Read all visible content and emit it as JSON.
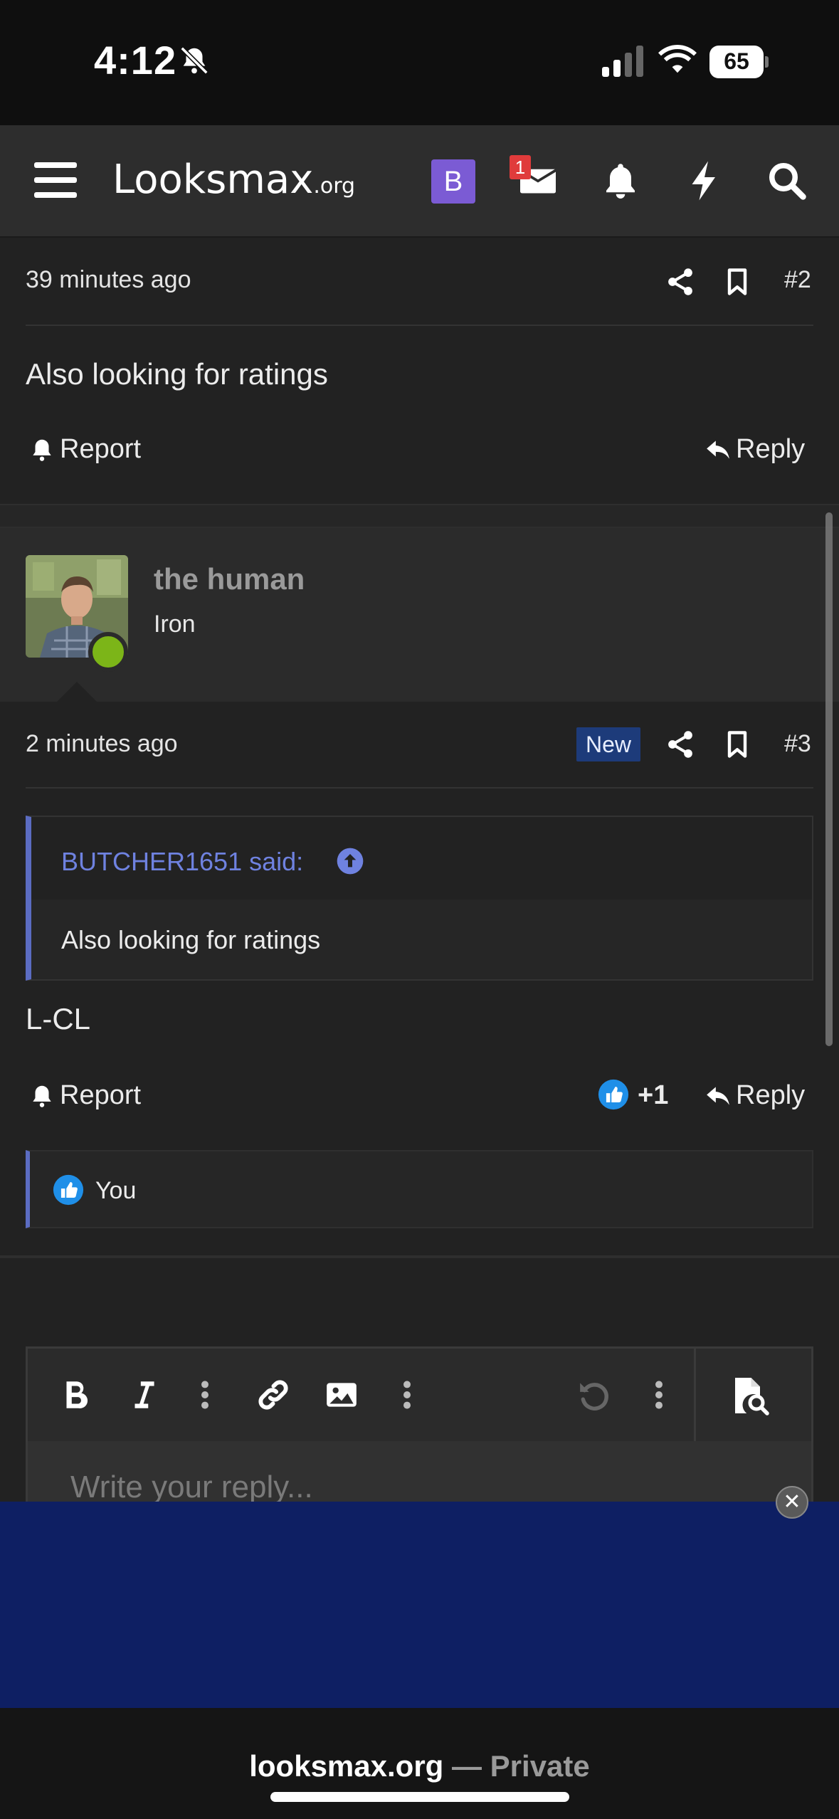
{
  "status_bar": {
    "time": "4:12",
    "battery": "65",
    "battery_level": 0.65
  },
  "nav": {
    "logo": "Looksmax",
    "logo_tld": ".org",
    "avatar_letter": "B",
    "inbox_badge": "1",
    "icons": [
      "menu-icon",
      "envelope-icon",
      "bell-icon",
      "bolt-icon",
      "search-icon"
    ]
  },
  "post2": {
    "time": "39 minutes ago",
    "number": "#2",
    "text": "Also looking for ratings",
    "report_label": "Report",
    "reply_label": "Reply"
  },
  "post3": {
    "username": "the human",
    "user_title": "Iron",
    "time": "2 minutes ago",
    "new_badge": "New",
    "number": "#3",
    "quote_author": "BUTCHER1651 said:",
    "quote_text": "Also looking for ratings",
    "text": "L-CL",
    "report_label": "Report",
    "reaction_count": "+1",
    "reply_label": "Reply",
    "likes_by": "You"
  },
  "editor": {
    "placeholder": "Write your reply..."
  },
  "address_bar": {
    "domain": "looksmax.org",
    "separator": " — ",
    "mode": "Private"
  },
  "colors": {
    "accent": "#5b6cc2",
    "online": "#7cb518",
    "ad_bg": "#0e1f63",
    "avatar_bg": "#7b5bd4"
  }
}
